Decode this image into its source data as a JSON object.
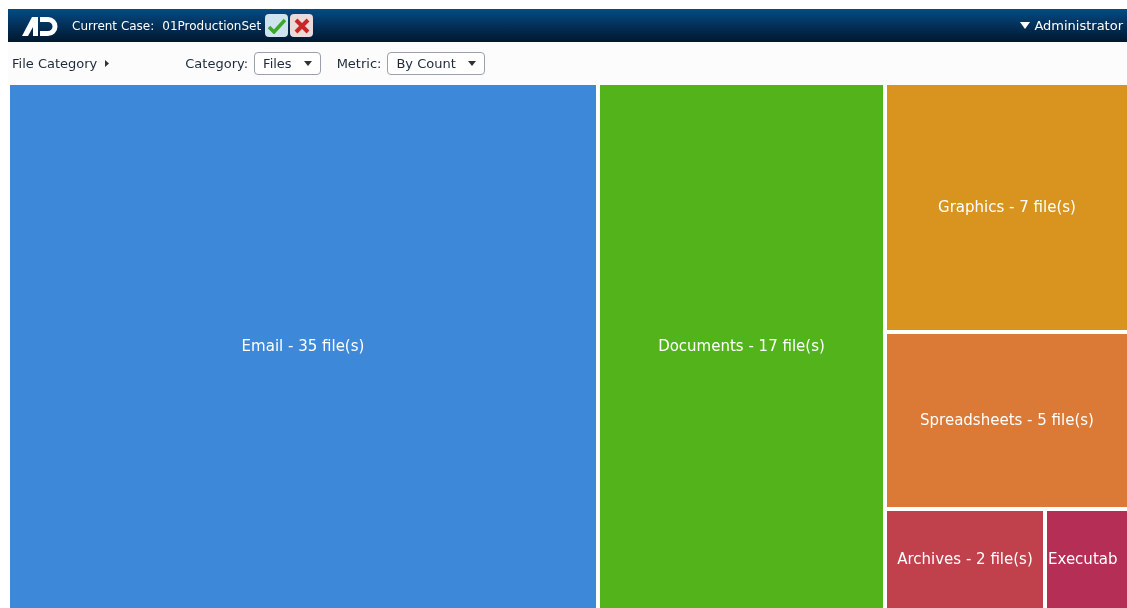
{
  "header": {
    "case_label": "Current Case:",
    "case_name": "01ProductionSet",
    "user": "Administrator"
  },
  "toolbar": {
    "breadcrumb": "File Category",
    "category_label": "Category:",
    "category_value": "Files",
    "metric_label": "Metric:",
    "metric_value": "By Count"
  },
  "treemap": [
    {
      "label": "Email - 35 file(s)",
      "color": "#3d88d8"
    },
    {
      "label": "Documents - 17 file(s)",
      "color": "#52b41a"
    },
    {
      "label": "Graphics - 7 file(s)",
      "color": "#d9941f"
    },
    {
      "label": "Spreadsheets - 5 file(s)",
      "color": "#db7a37"
    },
    {
      "label": "Archives - 2 file(s)",
      "color": "#c0404c"
    },
    {
      "label": "Executab",
      "color": "#b42e55"
    }
  ]
}
